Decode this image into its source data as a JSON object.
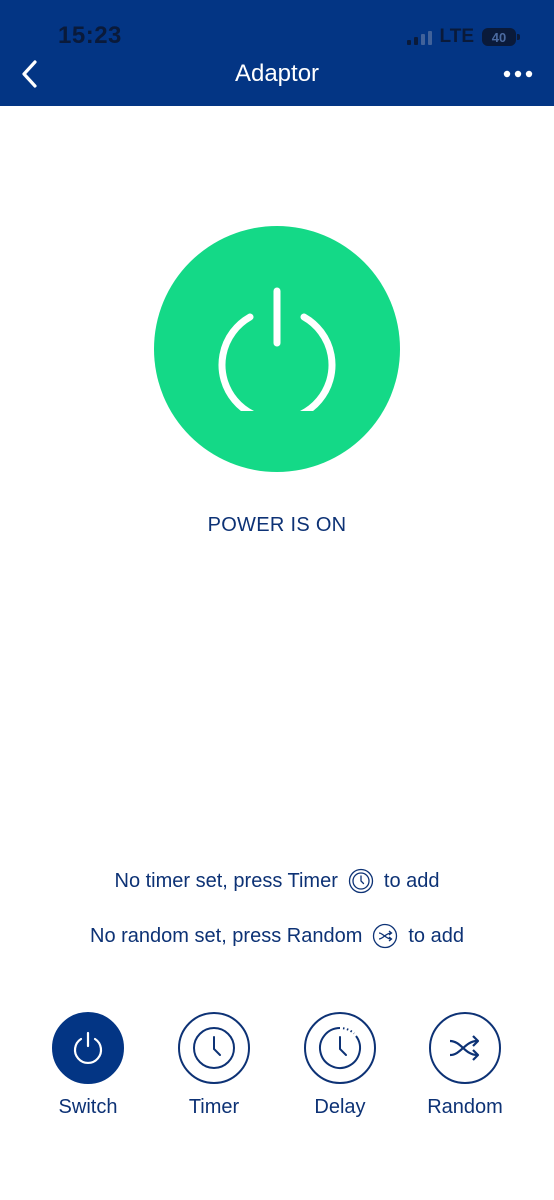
{
  "status_bar": {
    "time": "15:23",
    "network": "LTE",
    "battery_level": "40"
  },
  "header": {
    "title": "Adaptor",
    "back_icon": "chevron-left-icon",
    "more_icon": "more-horizontal-icon"
  },
  "power": {
    "state_text": "POWER IS ON",
    "is_on": true,
    "icon": "power-icon",
    "color_on": "#14d987"
  },
  "info": {
    "timer": {
      "prefix": "No timer set, press Timer",
      "suffix": "to add",
      "icon": "clock-icon"
    },
    "random": {
      "prefix": "No random set, press Random",
      "suffix": "to add",
      "icon": "shuffle-icon"
    }
  },
  "actions": [
    {
      "label": "Switch",
      "icon": "power-icon",
      "active": true
    },
    {
      "label": "Timer",
      "icon": "clock-icon",
      "active": false
    },
    {
      "label": "Delay",
      "icon": "delay-clock-icon",
      "active": false
    },
    {
      "label": "Random",
      "icon": "shuffle-icon",
      "active": false
    }
  ],
  "colors": {
    "header_bg": "#033584",
    "text_primary": "#0d3275",
    "power_on": "#14d987"
  }
}
